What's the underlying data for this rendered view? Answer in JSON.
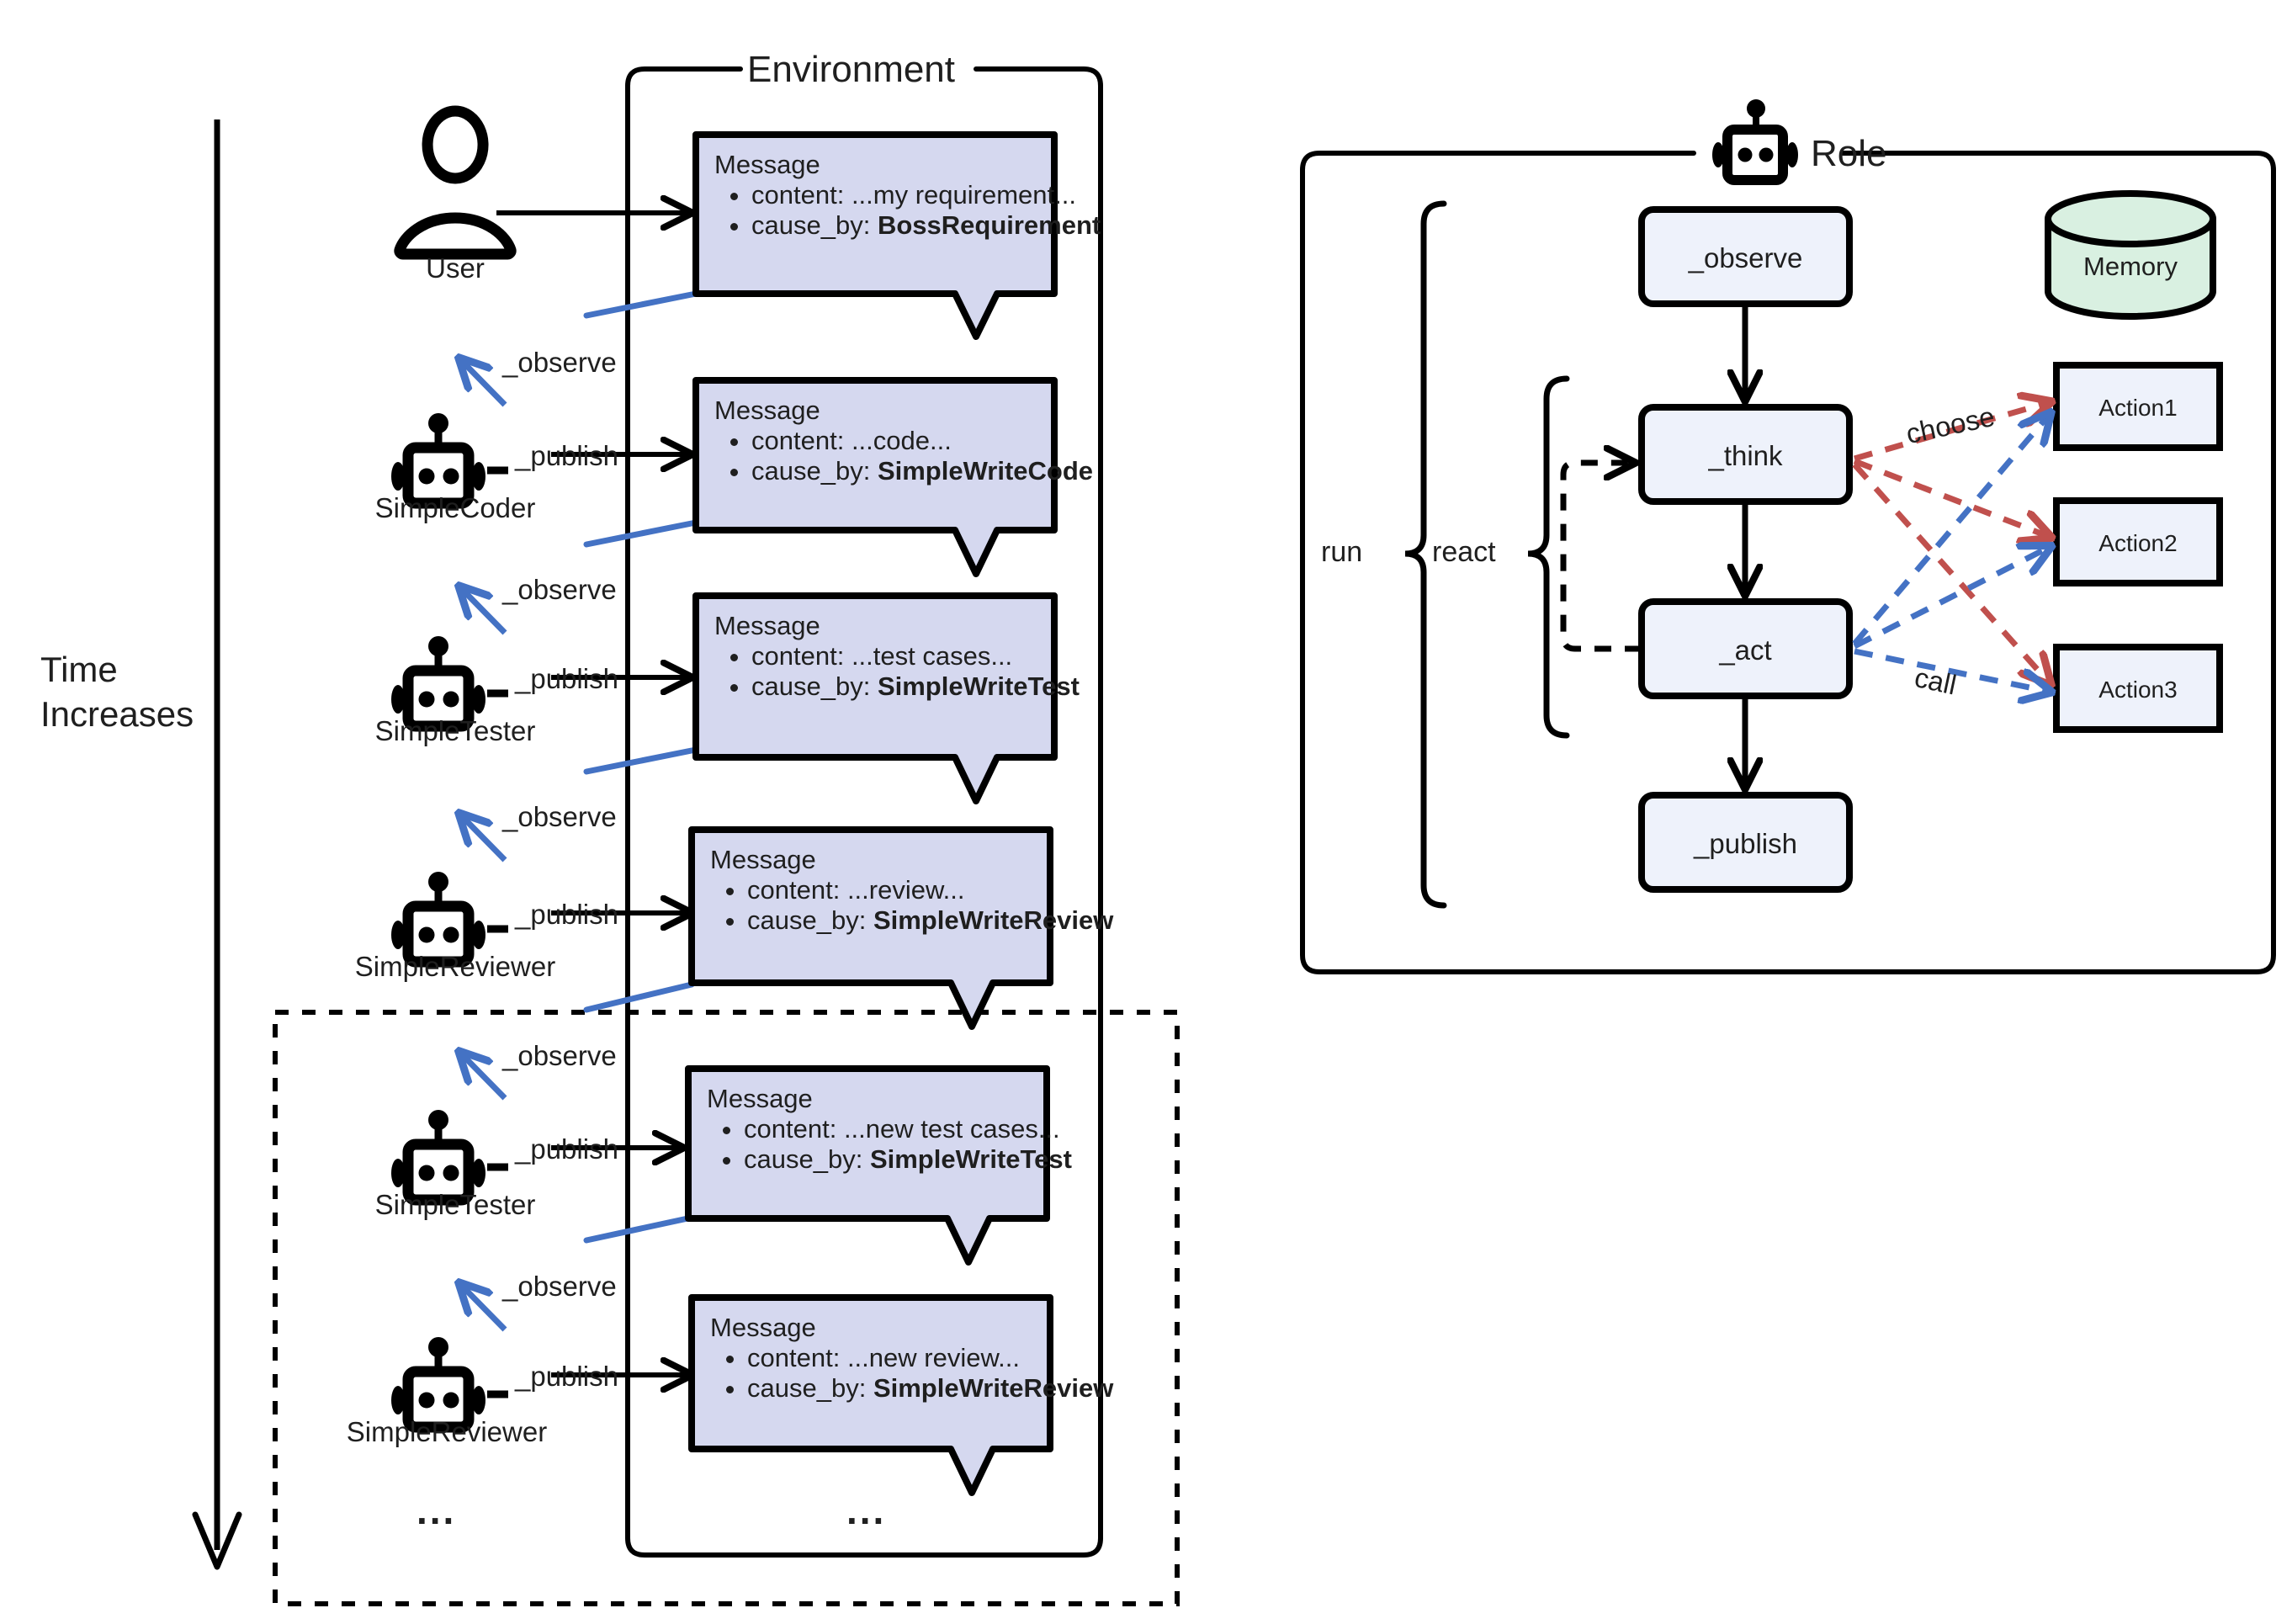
{
  "colors": {
    "message_fill": "#d5d8ef",
    "node_fill": "#eef2fb",
    "memory_fill": "#d9f0e1",
    "stroke": "#000000",
    "observe_arrow": "#4472c4",
    "choose_arrow": "#c0504d",
    "call_arrow": "#4472c4",
    "text": "#1f1f1f"
  },
  "timeline": {
    "axis_label_line1": "Time",
    "axis_label_line2": "Increases"
  },
  "environment": {
    "title": "Environment",
    "ellipsis_actor": "...",
    "ellipsis_message": "...",
    "rows": [
      {
        "actor": "User",
        "actor_icon": "user-icon",
        "publish_label": "",
        "observe_label": "",
        "message": {
          "title": "Message",
          "content_label": "content:",
          "content_value": "...my requirement...",
          "cause_label": "cause_by:",
          "cause_value": "BossRequirement"
        }
      },
      {
        "actor": "SimpleCoder",
        "actor_icon": "robot-icon",
        "publish_label": "_publish",
        "observe_label": "_observe",
        "message": {
          "title": "Message",
          "content_label": "content:",
          "content_value": "...code...",
          "cause_label": "cause_by:",
          "cause_value": "SimpleWriteCode"
        }
      },
      {
        "actor": "SimpleTester",
        "actor_icon": "robot-icon",
        "publish_label": "_publish",
        "observe_label": "_observe",
        "message": {
          "title": "Message",
          "content_label": "content:",
          "content_value": "...test cases...",
          "cause_label": "cause_by:",
          "cause_value": "SimpleWriteTest"
        }
      },
      {
        "actor": "SimpleReviewer",
        "actor_icon": "robot-icon",
        "publish_label": "_publish",
        "observe_label": "_observe",
        "message": {
          "title": "Message",
          "content_label": "content:",
          "content_value": "...review...",
          "cause_label": "cause_by:",
          "cause_value": "SimpleWriteReview"
        }
      },
      {
        "actor": "SimpleTester",
        "actor_icon": "robot-icon",
        "publish_label": "_publish",
        "observe_label": "_observe",
        "message": {
          "title": "Message",
          "content_label": "content:",
          "content_value": "...new test cases...",
          "cause_label": "cause_by:",
          "cause_value": "SimpleWriteTest"
        }
      },
      {
        "actor": "SimpleReviewer",
        "actor_icon": "robot-icon",
        "publish_label": "_publish",
        "observe_label": "_observe",
        "message": {
          "title": "Message",
          "content_label": "content:",
          "content_value": "...new review...",
          "cause_label": "cause_by:",
          "cause_value": "SimpleWriteReview"
        }
      }
    ]
  },
  "role": {
    "title": "Role",
    "title_icon": "robot-icon",
    "braces": {
      "run": "run",
      "react": "react"
    },
    "nodes": [
      {
        "id": "observe",
        "label": "_observe"
      },
      {
        "id": "think",
        "label": "_think"
      },
      {
        "id": "act",
        "label": "_act"
      },
      {
        "id": "publish",
        "label": "_publish"
      }
    ],
    "memory": {
      "label": "Memory",
      "icon": "database-cylinder-icon"
    },
    "actions": [
      {
        "label": "Action1"
      },
      {
        "label": "Action2"
      },
      {
        "label": "Action3"
      }
    ],
    "edges": {
      "choose": "choose",
      "call": "call"
    }
  }
}
